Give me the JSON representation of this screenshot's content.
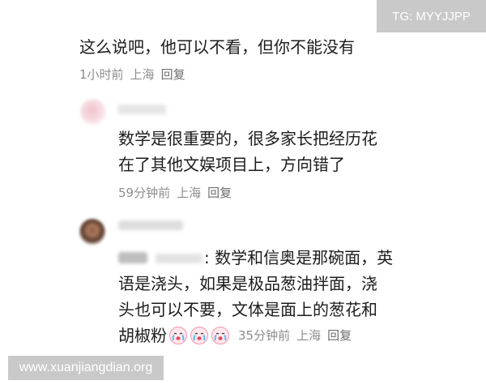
{
  "watermarks": {
    "top_right": "TG: MYYJJPP",
    "bottom_left": "www.xuanjiangdian.org"
  },
  "comments": [
    {
      "text_lines": [
        "这么说吧，他可以不看，但你不能没有"
      ],
      "meta": {
        "time": "1小时前",
        "location": "上海",
        "reply": "回复"
      }
    },
    {
      "username_blurred": true,
      "avatar": "pink-blurred-avatar",
      "text_lines": [
        "数学是很重要的，很多家长把经历花",
        "在了其他文娱项目上，方向错了"
      ],
      "meta": {
        "time": "59分钟前",
        "location": "上海",
        "reply": "回复"
      }
    },
    {
      "username_blurred": true,
      "avatar": "brown-blurred-avatar",
      "reply_to_blurred": true,
      "text_lines": [
        ": 数学和信奥是那碗面，英",
        "语是浇头，如果是极品葱油拌面，浇",
        "头也可以不要，文体是面上的葱花和",
        "胡椒粉"
      ],
      "emojis": [
        "crying-face-emoji",
        "crying-face-emoji",
        "crying-face-emoji"
      ],
      "meta": {
        "time": "35分钟前",
        "location": "上海",
        "reply": "回复"
      }
    }
  ],
  "colors": {
    "text": "#1c1c1c",
    "meta": "#8d8d8d",
    "watermark_bg": "#c9c9c9"
  }
}
